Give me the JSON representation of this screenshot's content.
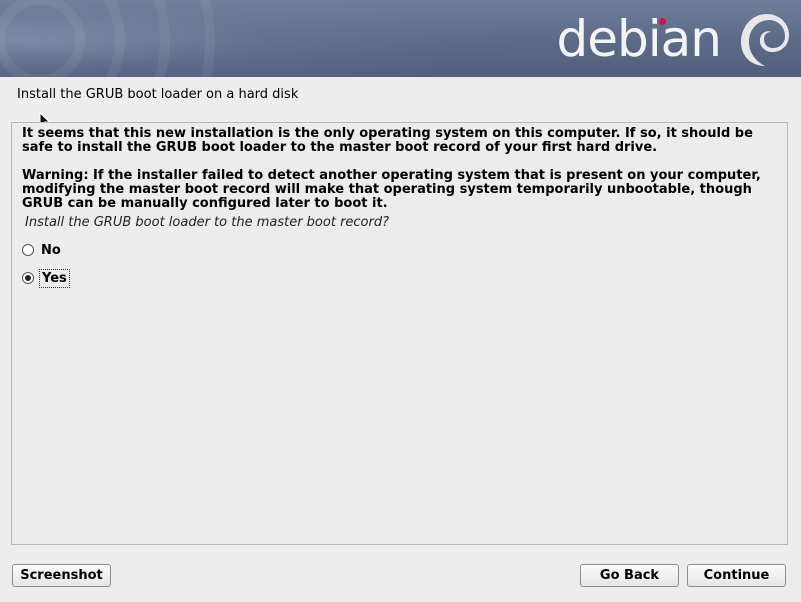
{
  "header": {
    "logo_text": "debian",
    "accent_color": "#d70a53"
  },
  "title": "Install the GRUB boot loader on a hard disk",
  "body": {
    "paragraph1": "It seems that this new installation is the only operating system on this computer. If so, it should be safe to install the GRUB boot loader to the master boot record of your first hard drive.",
    "paragraph2": "Warning: If the installer failed to detect another operating system that is present on your computer, modifying the master boot record will make that operating system temporarily unbootable, though GRUB can be manually configured later to boot it.",
    "question": "Install the GRUB boot loader to the master boot record?",
    "options": [
      {
        "label": "No",
        "selected": false
      },
      {
        "label": "Yes",
        "selected": true
      }
    ]
  },
  "footer": {
    "screenshot_label": "Screenshot",
    "back_label": "Go Back",
    "continue_label": "Continue"
  }
}
